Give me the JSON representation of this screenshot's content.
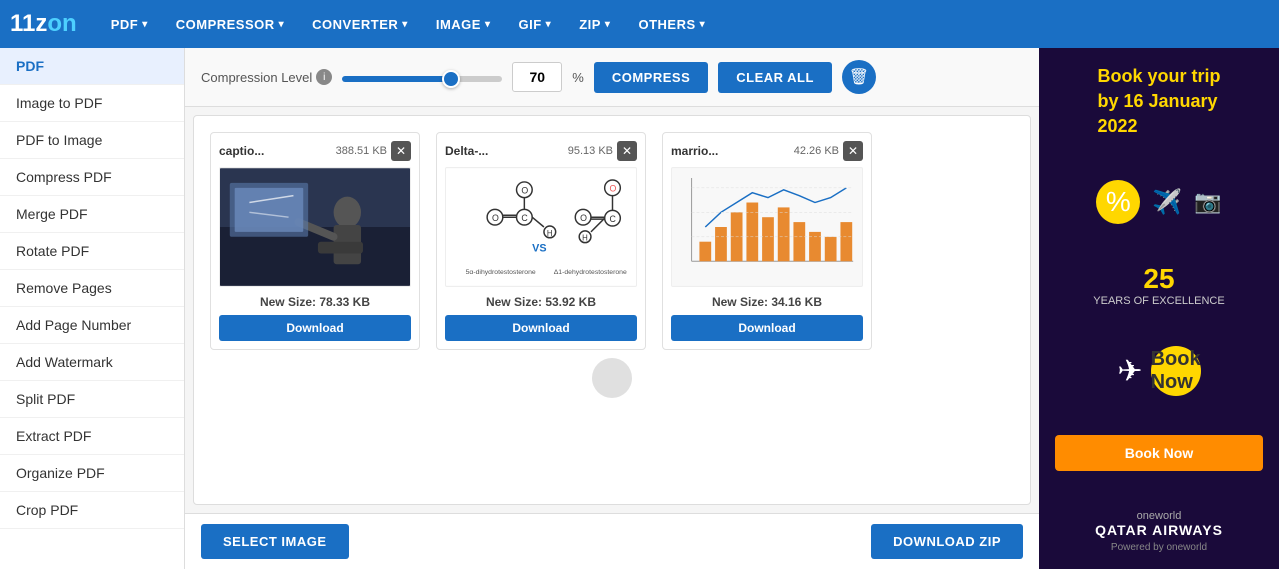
{
  "logo": {
    "text1": "11z",
    "text2": "n"
  },
  "nav": {
    "items": [
      {
        "label": "PDF",
        "id": "pdf"
      },
      {
        "label": "COMPRESSOR",
        "id": "compressor"
      },
      {
        "label": "CONVERTER",
        "id": "converter"
      },
      {
        "label": "IMAGE",
        "id": "image"
      },
      {
        "label": "GIF",
        "id": "gif"
      },
      {
        "label": "ZIP",
        "id": "zip"
      },
      {
        "label": "OTHERS",
        "id": "others"
      }
    ]
  },
  "sidebar": {
    "items": [
      {
        "label": "PDF",
        "id": "pdf-section",
        "active": true
      },
      {
        "label": "Image to PDF",
        "id": "image-to-pdf"
      },
      {
        "label": "PDF to Image",
        "id": "pdf-to-image"
      },
      {
        "label": "Compress PDF",
        "id": "compress-pdf"
      },
      {
        "label": "Merge PDF",
        "id": "merge-pdf"
      },
      {
        "label": "Rotate PDF",
        "id": "rotate-pdf"
      },
      {
        "label": "Remove Pages",
        "id": "remove-pages"
      },
      {
        "label": "Add Page Number",
        "id": "add-page-number"
      },
      {
        "label": "Add Watermark",
        "id": "add-watermark"
      },
      {
        "label": "Split PDF",
        "id": "split-pdf"
      },
      {
        "label": "Extract PDF",
        "id": "extract-pdf"
      },
      {
        "label": "Organize PDF",
        "id": "organize-pdf"
      },
      {
        "label": "Crop PDF",
        "id": "crop-pdf"
      }
    ]
  },
  "toolbar": {
    "compression_label": "Compression Level",
    "compression_value": "70",
    "percent_sign": "%",
    "compress_btn": "COMPRESS",
    "clear_btn": "CLEAR ALL"
  },
  "files": [
    {
      "name": "captio...",
      "size": "388.51 KB",
      "new_size": "New Size: 78.33 KB",
      "download_label": "Download",
      "thumb_type": "person"
    },
    {
      "name": "Delta-...",
      "size": "95.13 KB",
      "new_size": "New Size: 53.92 KB",
      "download_label": "Download",
      "thumb_type": "chem"
    },
    {
      "name": "marrio...",
      "size": "42.26 KB",
      "new_size": "New Size: 34.16 KB",
      "download_label": "Download",
      "thumb_type": "chart"
    }
  ],
  "bottom": {
    "select_label": "SELECT IMAGE",
    "download_zip_label": "DOWNLOAD ZIP"
  },
  "ad": {
    "line1": "Book your trip",
    "line2": "by 16 January",
    "line3": "2022",
    "years": "25",
    "years_text": "YEARS OF EXCELLENCE",
    "book_now": "Book Now",
    "brand": "oneworld",
    "airline": "QATAR AIRWAYS",
    "percent_icon": "%"
  }
}
